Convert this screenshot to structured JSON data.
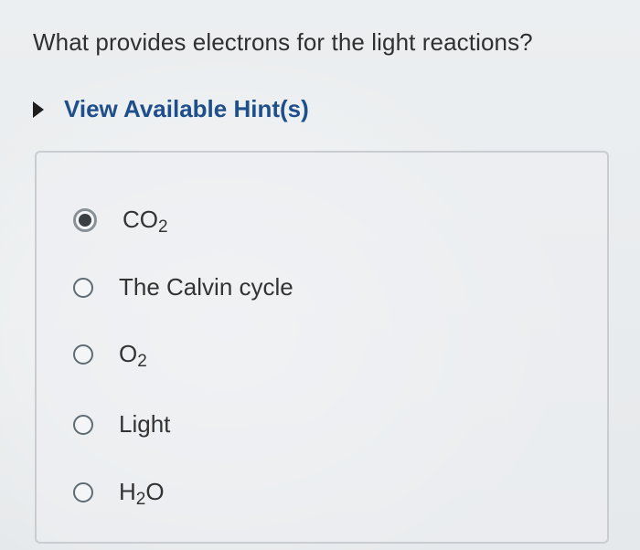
{
  "question": {
    "text": "What provides electrons for the light reactions?"
  },
  "hint": {
    "label": "View Available Hint(s)"
  },
  "options": [
    {
      "base": "CO",
      "sub": "2",
      "suffix": "",
      "selected": true
    },
    {
      "base": "The Calvin cycle",
      "sub": "",
      "suffix": "",
      "selected": false
    },
    {
      "base": "O",
      "sub": "2",
      "suffix": "",
      "selected": false
    },
    {
      "base": "Light",
      "sub": "",
      "suffix": "",
      "selected": false
    },
    {
      "base": "H",
      "sub": "2",
      "suffix": "O",
      "selected": false
    }
  ],
  "colors": {
    "hint_link": "#1f4f8a",
    "text": "#303030"
  }
}
